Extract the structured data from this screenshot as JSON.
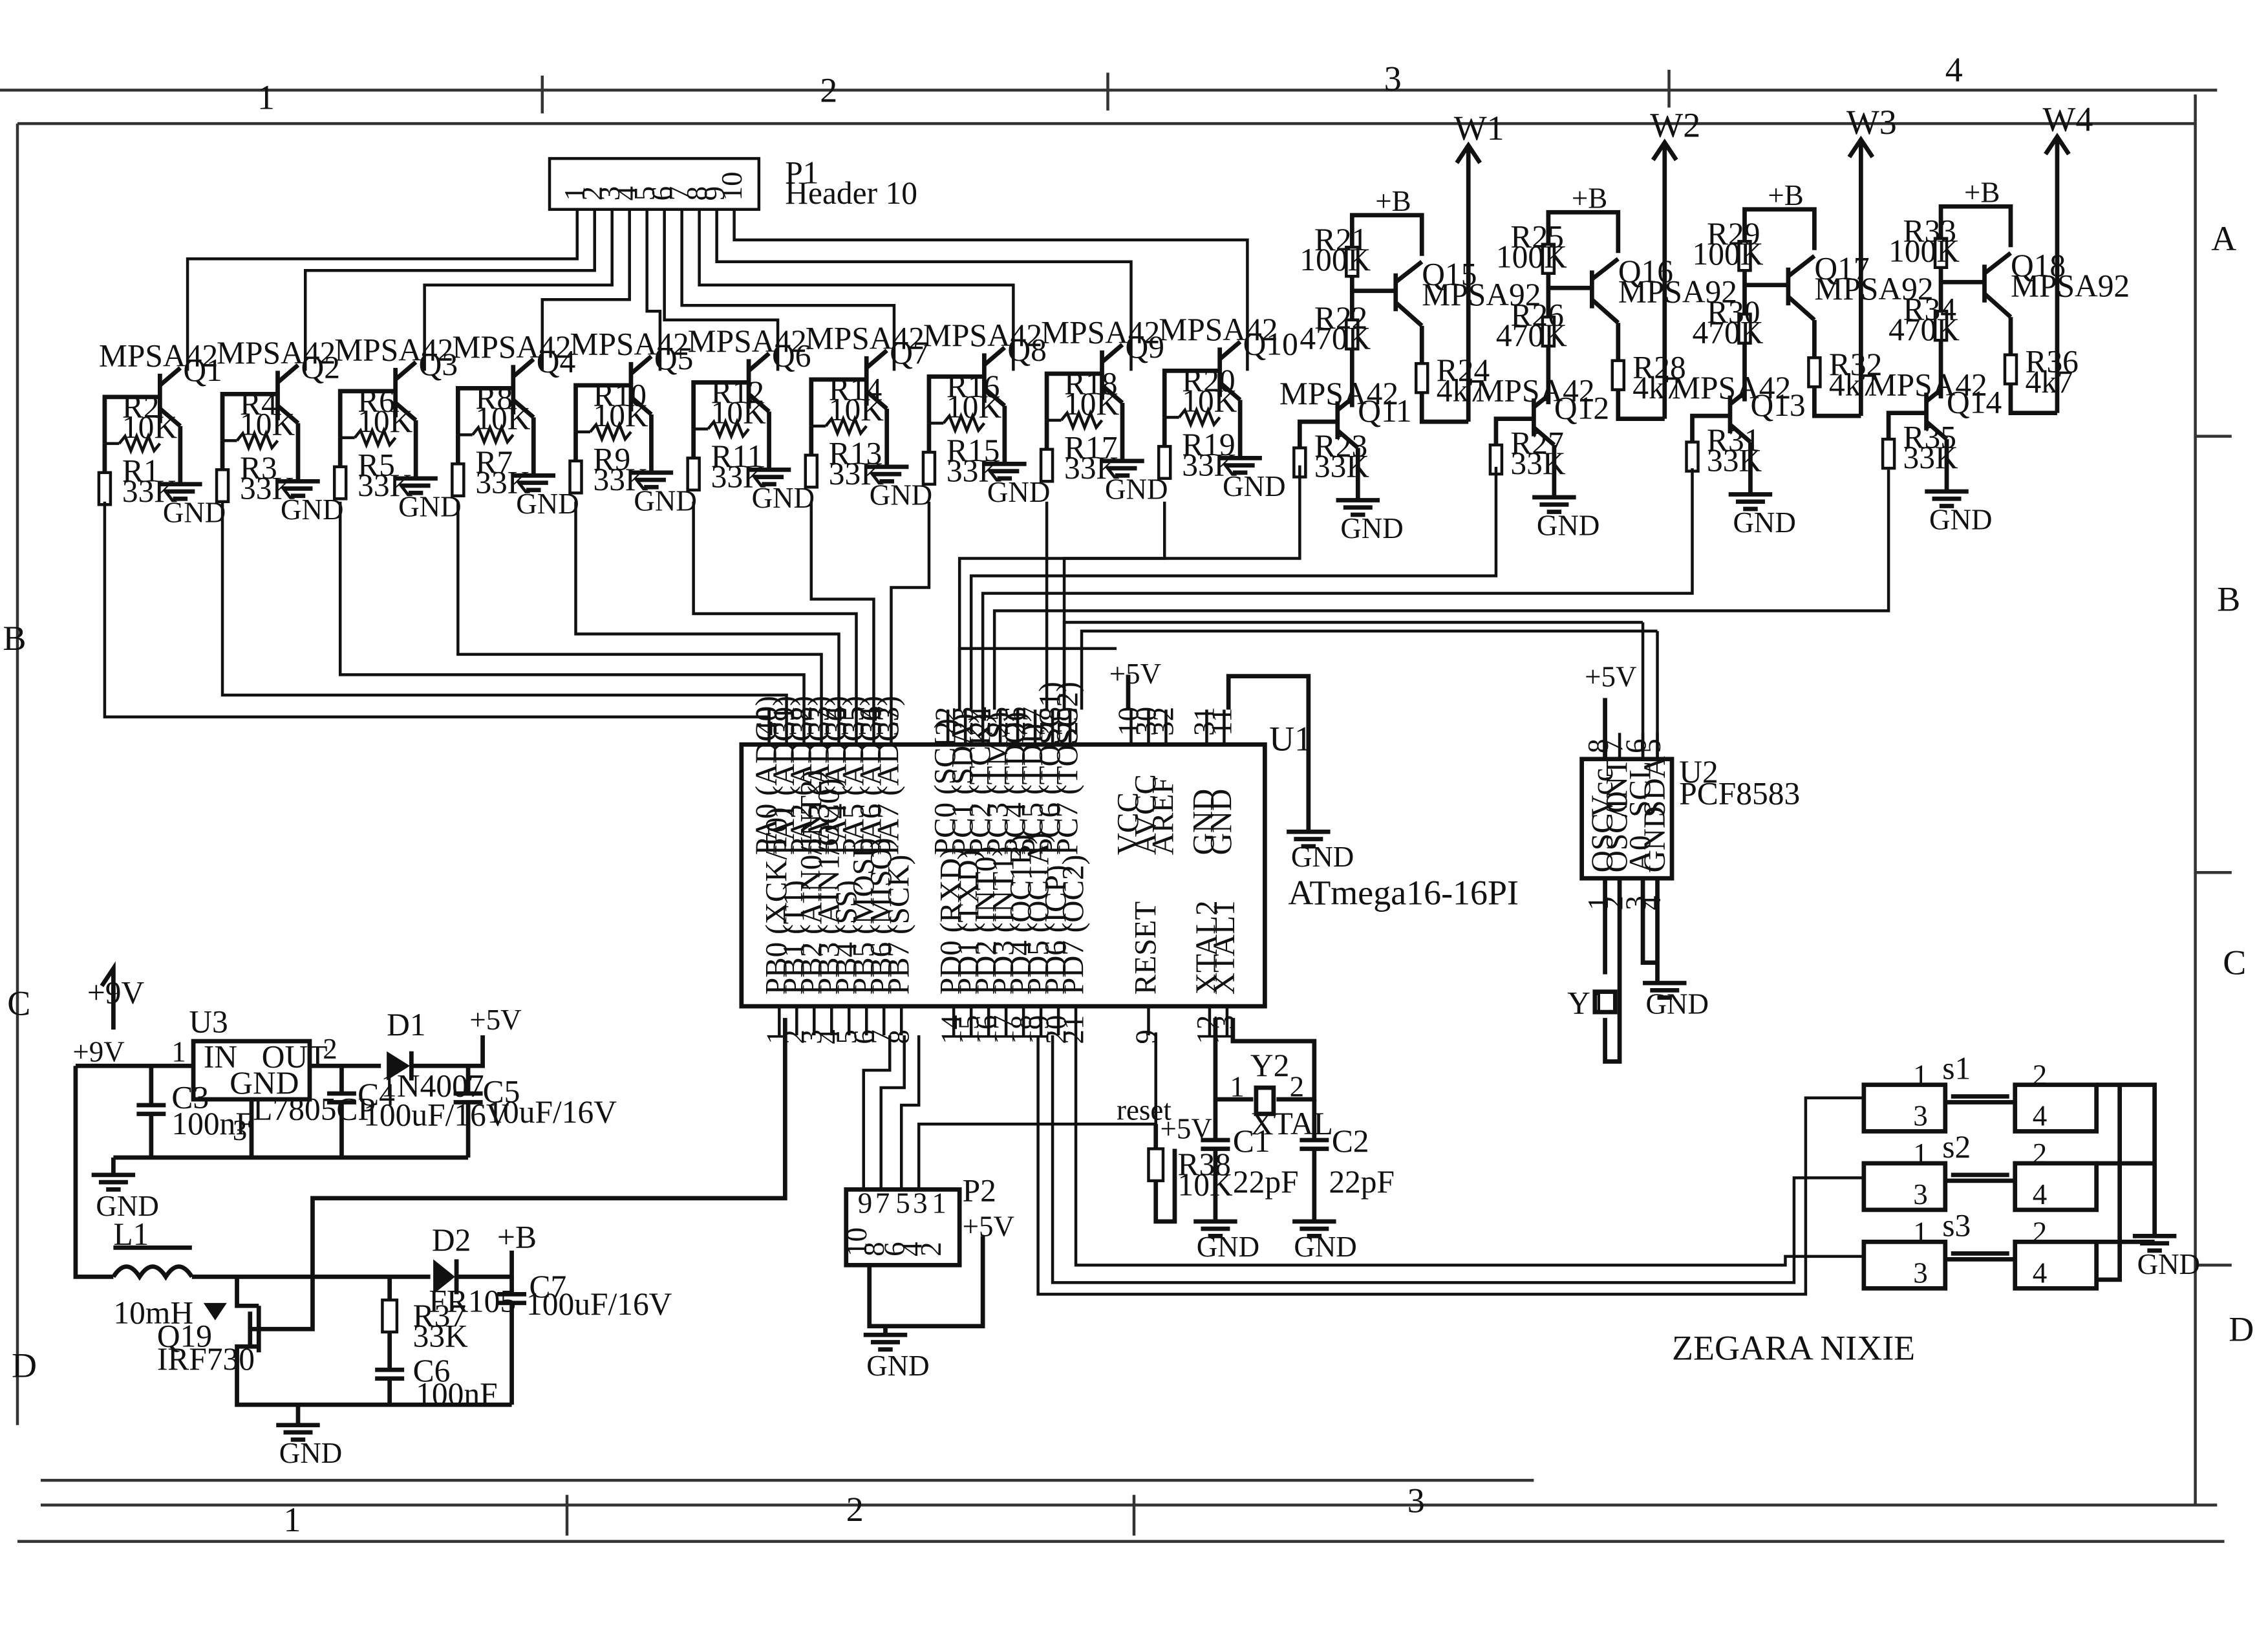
{
  "sheet": {
    "title": "ZEGARA NIXIE",
    "zones_top": [
      "1",
      "2",
      "3",
      "4"
    ],
    "zones_bottom": [
      "1",
      "2",
      "3"
    ],
    "zones_right": [
      "A",
      "B",
      "C",
      "D"
    ],
    "zones_left": [
      "B",
      "C",
      "D"
    ]
  },
  "header": {
    "ref": "P1",
    "value": "Header 10",
    "pins": [
      "1",
      "2",
      "3",
      "4",
      "5",
      "6",
      "7",
      "8",
      "9",
      "10"
    ]
  },
  "drivers": [
    {
      "q": "Q1",
      "part": "MPSA42",
      "rb": "R2",
      "rbv": "10K",
      "rp": "R1",
      "rpv": "33K"
    },
    {
      "q": "Q2",
      "part": "MPSA42",
      "rb": "R4",
      "rbv": "10K",
      "rp": "R3",
      "rpv": "33K"
    },
    {
      "q": "Q3",
      "part": "MPSA42",
      "rb": "R6",
      "rbv": "10K",
      "rp": "R5",
      "rpv": "33K"
    },
    {
      "q": "Q4",
      "part": "MPSA42",
      "rb": "R8",
      "rbv": "10K",
      "rp": "R7",
      "rpv": "33K"
    },
    {
      "q": "Q5",
      "part": "MPSA42",
      "rb": "R10",
      "rbv": "10K",
      "rp": "R9",
      "rpv": "33K"
    },
    {
      "q": "Q6",
      "part": "MPSA42",
      "rb": "R12",
      "rbv": "10K",
      "rp": "R11",
      "rpv": "33K"
    },
    {
      "q": "Q7",
      "part": "MPSA42",
      "rb": "R14",
      "rbv": "10K",
      "rp": "R13",
      "rpv": "33K"
    },
    {
      "q": "Q8",
      "part": "MPSA42",
      "rb": "R16",
      "rbv": "10K",
      "rp": "R15",
      "rpv": "33K"
    },
    {
      "q": "Q9",
      "part": "MPSA42",
      "rb": "R18",
      "rbv": "10K",
      "rp": "R17",
      "rpv": "33K"
    },
    {
      "q": "Q10",
      "part": "MPSA42",
      "rb": "R20",
      "rbv": "10K",
      "rp": "R19",
      "rpv": "33K"
    }
  ],
  "anode_drivers": [
    {
      "out": "W1",
      "supply": "+B",
      "qhi": "Q15",
      "qhi_part": "MPSA92",
      "r_top": "R21",
      "r_top_v": "100K",
      "r_mid": "R22",
      "r_mid_v": "470K",
      "r_out": "R24",
      "r_out_v": "4k7",
      "qlo": "Q11",
      "qlo_part": "MPSA42",
      "r_lo": "R23",
      "r_lo_v": "33K"
    },
    {
      "out": "W2",
      "supply": "+B",
      "qhi": "Q16",
      "qhi_part": "MPSA92",
      "r_top": "R25",
      "r_top_v": "100K",
      "r_mid": "R26",
      "r_mid_v": "470K",
      "r_out": "R28",
      "r_out_v": "4k7",
      "qlo": "Q12",
      "qlo_part": "MPSA42",
      "r_lo": "R27",
      "r_lo_v": "33K"
    },
    {
      "out": "W3",
      "supply": "+B",
      "qhi": "Q17",
      "qhi_part": "MPSA92",
      "r_top": "R29",
      "r_top_v": "100K",
      "r_mid": "R30",
      "r_mid_v": "470K",
      "r_out": "R32",
      "r_out_v": "4k7",
      "qlo": "Q13",
      "qlo_part": "MPSA42",
      "r_lo": "R31",
      "r_lo_v": "33K"
    },
    {
      "out": "W4",
      "supply": "+B",
      "qhi": "Q18",
      "qhi_part": "MPSA92",
      "r_top": "R33",
      "r_top_v": "100K",
      "r_mid": "R34",
      "r_mid_v": "470K",
      "r_out": "R36",
      "r_out_v": "4k7",
      "qlo": "Q14",
      "qlo_part": "MPSA42",
      "r_lo": "R35",
      "r_lo_v": "33K"
    }
  ],
  "mcu": {
    "ref": "U1",
    "part": "ATmega16-16PI",
    "top_pins": [
      "PA0 (ADC0)",
      "PA1 (ADC1)",
      "PA2 (ADC2)",
      "PA3 (ADC3)",
      "PA4 (ADC4)",
      "PA5 (ADC5)",
      "PA6 (ADC6)",
      "PA7 (ADC7)",
      "PC0 (SCL)",
      "PC1 (SDA)",
      "PC2 (TCK)",
      "PC3 (TMS)",
      "PC4 (TDO)",
      "PC5 (TDI)",
      "PC6 (TOSC1)",
      "PC7 (TOSC2)",
      "VCC",
      "AVCC",
      "AREF",
      "GND",
      "GND"
    ],
    "top_nums": [
      "40",
      "39",
      "38",
      "37",
      "36",
      "35",
      "34",
      "33",
      "22",
      "23",
      "24",
      "25",
      "26",
      "27",
      "28",
      "29",
      "10",
      "30",
      "32",
      "31",
      "11"
    ],
    "bottom_pins": [
      "PB0 (XCK/T0)",
      "PB1 (T1)",
      "PB2 (AIN0/INT2)",
      "PB3 (AIN1/OC0)",
      "PB4 (SS)",
      "PB5 (MOSI)",
      "PB6 (MISO)",
      "PB7 (SCK)",
      "PD0 (RXD)",
      "PD1 (TXD)",
      "PD2 (INT0)",
      "PD3 (INT1)",
      "PD4 (OC1B)",
      "PD5 (OC1A)",
      "PD6 (ICP)",
      "PD7 (OC2)",
      "RESET",
      "XTAL2",
      "XTAL1"
    ],
    "bottom_nums": [
      "1",
      "2",
      "3",
      "4",
      "5",
      "6",
      "7",
      "8",
      "14",
      "15",
      "16",
      "17",
      "18",
      "19",
      "20",
      "21",
      "9",
      "12",
      "13"
    ]
  },
  "rtc": {
    "ref": "U2",
    "part": "PCF8583",
    "top_pins": [
      "Vcc",
      "/INT",
      "SCL",
      "SDA"
    ],
    "top_nums": [
      "8",
      "7",
      "6",
      "5"
    ],
    "bottom_pins": [
      "OSC",
      "OSCO",
      "A0",
      "GND"
    ],
    "bottom_nums": [
      "1",
      "2",
      "3",
      "4"
    ],
    "crystal": "Y1"
  },
  "power": {
    "vin": "+9V",
    "reg_ref": "U3",
    "reg_part": "L7805CP",
    "reg_in": "IN",
    "reg_out": "OUT",
    "reg_gnd": "GND",
    "reg_pins": [
      "1",
      "2",
      "3"
    ],
    "d1": "D1",
    "d1_part": "1N4007",
    "vout": "+5V",
    "c3": "C3",
    "c3v": "100nF",
    "c4": "C4",
    "c4v": "100uF/16V",
    "c5": "C5",
    "c5v": "10uF/16V"
  },
  "boost": {
    "l": "L1",
    "lv": "10mH",
    "q": "Q19",
    "qv": "IRF730",
    "d": "D2",
    "dv": "FR105",
    "out": "+B",
    "c7": "C7",
    "c7v": "100uF/16V",
    "r": "R37",
    "rv": "33K",
    "c6": "C6",
    "c6v": "100nF"
  },
  "isp": {
    "ref": "P2",
    "top": [
      "9",
      "7",
      "5",
      "3",
      "1"
    ],
    "bottom": [
      "10",
      "8",
      "6",
      "4",
      "2"
    ],
    "supply": "+5V"
  },
  "reset": {
    "net": "reset",
    "supply": "+5V",
    "r": "R38",
    "rv": "10K"
  },
  "xtal": {
    "ref": "Y2",
    "label": "XTAL",
    "pins": [
      "1",
      "2"
    ],
    "c1": "C1",
    "c1v": "22pF",
    "c2": "C2",
    "c2v": "22pF"
  },
  "switches": [
    {
      "ref": "s1",
      "pins": [
        "1",
        "2",
        "3",
        "4"
      ]
    },
    {
      "ref": "s2",
      "pins": [
        "1",
        "2",
        "3",
        "4"
      ]
    },
    {
      "ref": "s3",
      "pins": [
        "1",
        "2",
        "3",
        "4"
      ]
    }
  ],
  "labels": {
    "gnd": "GND",
    "vcc5": "+5V"
  }
}
